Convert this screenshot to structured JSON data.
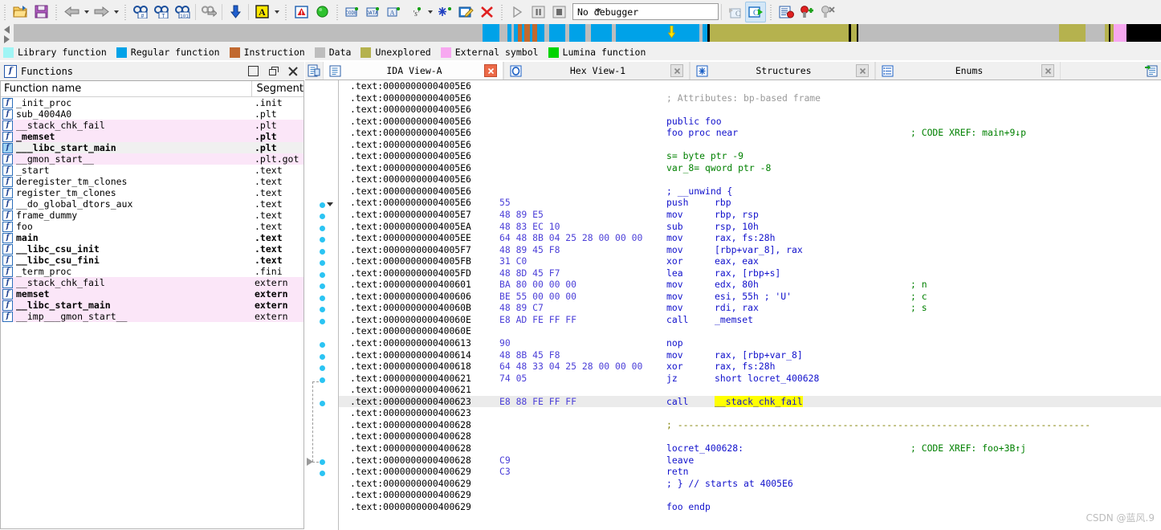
{
  "toolbar": {
    "groups": [
      {
        "items": [
          {
            "name": "open-file-icon",
            "label": "Open"
          },
          {
            "name": "save-icon",
            "label": "Save"
          }
        ]
      },
      {
        "items": [
          {
            "name": "back-arrow-icon",
            "label": "Back"
          },
          {
            "name": "back-dropdown-icon",
            "label": "Back history"
          },
          {
            "name": "forward-arrow-icon",
            "label": "Forward"
          },
          {
            "name": "forward-dropdown-icon",
            "label": "Forward history"
          }
        ]
      },
      {
        "items": [
          {
            "name": "jump-to-address-icon",
            "label": "Jump to address"
          },
          {
            "name": "jump-to-name-icon",
            "label": "Jump by name"
          },
          {
            "name": "jump-to-entry-icon",
            "label": "Jump to entry point"
          },
          {
            "name": "jump-to-xref-icon",
            "label": "Jump to xref"
          },
          {
            "name": "search-down-icon",
            "label": "Search down"
          },
          {
            "name": "text-search-icon",
            "label": "Text search"
          },
          {
            "name": "text-search-dropdown-icon",
            "label": "Search options"
          },
          {
            "name": "warning-icon",
            "label": "Problems"
          },
          {
            "name": "green-circle-icon",
            "label": "Run"
          }
        ]
      },
      {
        "items": [
          {
            "name": "make-code-icon",
            "label": "Make code"
          },
          {
            "name": "make-data-icon",
            "label": "Make data"
          },
          {
            "name": "make-array-icon",
            "label": "Make array"
          },
          {
            "name": "make-string-icon",
            "label": "Make string"
          },
          {
            "name": "make-string-dropdown-icon",
            "label": "String options"
          },
          {
            "name": "make-struct-icon",
            "label": "Make struct"
          },
          {
            "name": "edit-function-icon",
            "label": "Edit function"
          },
          {
            "name": "undefine-icon",
            "label": "Undefine"
          }
        ]
      },
      {
        "items": [
          {
            "name": "run-debugger-icon",
            "label": "Start process"
          },
          {
            "name": "pause-debugger-icon",
            "label": "Pause process"
          },
          {
            "name": "stop-debugger-icon",
            "label": "Terminate process"
          }
        ]
      }
    ],
    "debugger_select": {
      "value": "No debugger",
      "placeholder": "No debugger"
    },
    "post_select": [
      {
        "name": "step-over-source-icon",
        "label": "Step over (source)"
      },
      {
        "name": "step-into-source-icon",
        "label": "Step into (source)"
      },
      {
        "name": "breakpoint-list-icon",
        "label": "Breakpoint list"
      },
      {
        "name": "add-breakpoint-icon",
        "label": "Add breakpoint"
      },
      {
        "name": "delete-breakpoint-icon",
        "label": "Delete breakpoint"
      }
    ]
  },
  "navband": {
    "cursor_position_pct": 57.3,
    "segments": [
      {
        "color": "#bdbdbd",
        "w": 57.2
      },
      {
        "color": "#00a2e8",
        "w": 2.1
      },
      {
        "color": "#bdbdbd",
        "w": 0.9
      },
      {
        "color": "#00a2e8",
        "w": 0.5
      },
      {
        "color": "#bdbdbd",
        "w": 0.3
      },
      {
        "color": "#00a2e8",
        "w": 0.5
      },
      {
        "color": "#c1692f",
        "w": 0.5
      },
      {
        "color": "#00a2e8",
        "w": 0.3
      },
      {
        "color": "#c1692f",
        "w": 0.7
      },
      {
        "color": "#00a2e8",
        "w": 0.3
      },
      {
        "color": "#c1692f",
        "w": 0.6
      },
      {
        "color": "#00a2e8",
        "w": 0.9
      },
      {
        "color": "#bdbdbd",
        "w": 0.5
      },
      {
        "color": "#00a2e8",
        "w": 2.0
      },
      {
        "color": "#bdbdbd",
        "w": 0.5
      },
      {
        "color": "#00a2e8",
        "w": 2.0
      },
      {
        "color": "#bdbdbd",
        "w": 0.6
      },
      {
        "color": "#00a2e8",
        "w": 2.6
      },
      {
        "color": "#bdbdbd",
        "w": 0.5
      },
      {
        "color": "#00a2e8",
        "w": 10.2
      },
      {
        "color": "#bdbdbd",
        "w": 0.4
      },
      {
        "color": "#00a2e8",
        "w": 0.5
      },
      {
        "color": "#000000",
        "w": 0.3
      },
      {
        "color": "#b5b24e",
        "w": 17.0
      },
      {
        "color": "#000000",
        "w": 0.3
      },
      {
        "color": "#b5b24e",
        "w": 0.7
      },
      {
        "color": "#000000",
        "w": 0.2
      },
      {
        "color": "#bdbdbd",
        "w": 24.5
      },
      {
        "color": "#b5b24e",
        "w": 3.2
      },
      {
        "color": "#bdbdbd",
        "w": 2.3
      },
      {
        "color": "#b5b24e",
        "w": 0.5
      },
      {
        "color": "#000000",
        "w": 0.2
      },
      {
        "color": "#b5b24e",
        "w": 0.4
      },
      {
        "color": "#f7a8f0",
        "w": 1.6
      },
      {
        "color": "#000000",
        "w": 4.2
      }
    ]
  },
  "legend": {
    "items": [
      {
        "label": "Library function",
        "color": "#a0f5f5"
      },
      {
        "label": "Regular function",
        "color": "#00a2e8"
      },
      {
        "label": "Instruction",
        "color": "#c1692f"
      },
      {
        "label": "Data",
        "color": "#bdbdbd"
      },
      {
        "label": "Unexplored",
        "color": "#b5b24e"
      },
      {
        "label": "External symbol",
        "color": "#f7a8f0"
      },
      {
        "label": "Lumina function",
        "color": "#00d400"
      }
    ]
  },
  "functions_panel": {
    "title": "Functions",
    "icon": "function-f-icon",
    "window_buttons": [
      {
        "name": "maximize-button",
        "label": "Maximize"
      },
      {
        "name": "restore-button",
        "label": "Restore"
      },
      {
        "name": "close-button",
        "label": "Close"
      }
    ],
    "columns": [
      "Function name",
      "Segment"
    ],
    "rows": [
      {
        "name": "_init_proc",
        "segment": ".init",
        "bold": false,
        "bg": "white",
        "icon_sel": false
      },
      {
        "name": "sub_4004A0",
        "segment": ".plt",
        "bold": false,
        "bg": "white",
        "icon_sel": false
      },
      {
        "name": "__stack_chk_fail",
        "segment": ".plt",
        "bold": false,
        "bg": "pink",
        "icon_sel": false
      },
      {
        "name": "_memset",
        "segment": ".plt",
        "bold": true,
        "bg": "pink",
        "icon_sel": false
      },
      {
        "name": "___libc_start_main",
        "segment": ".plt",
        "bold": true,
        "bg": "grey",
        "icon_sel": true
      },
      {
        "name": "__gmon_start__",
        "segment": ".plt.got",
        "bold": false,
        "bg": "pink",
        "icon_sel": false
      },
      {
        "name": "_start",
        "segment": ".text",
        "bold": false,
        "bg": "white",
        "icon_sel": false
      },
      {
        "name": "deregister_tm_clones",
        "segment": ".text",
        "bold": false,
        "bg": "white",
        "icon_sel": false
      },
      {
        "name": "register_tm_clones",
        "segment": ".text",
        "bold": false,
        "bg": "white",
        "icon_sel": false
      },
      {
        "name": "__do_global_dtors_aux",
        "segment": ".text",
        "bold": false,
        "bg": "white",
        "icon_sel": false
      },
      {
        "name": "frame_dummy",
        "segment": ".text",
        "bold": false,
        "bg": "white",
        "icon_sel": false
      },
      {
        "name": "foo",
        "segment": ".text",
        "bold": false,
        "bg": "white",
        "icon_sel": false
      },
      {
        "name": "main",
        "segment": ".text",
        "bold": true,
        "bg": "white",
        "icon_sel": false
      },
      {
        "name": "__libc_csu_init",
        "segment": ".text",
        "bold": true,
        "bg": "white",
        "icon_sel": false
      },
      {
        "name": "__libc_csu_fini",
        "segment": ".text",
        "bold": true,
        "bg": "white",
        "icon_sel": false
      },
      {
        "name": "_term_proc",
        "segment": ".fini",
        "bold": false,
        "bg": "white",
        "icon_sel": false
      },
      {
        "name": "__stack_chk_fail",
        "segment": "extern",
        "bold": false,
        "bg": "pink",
        "icon_sel": false
      },
      {
        "name": "memset",
        "segment": "extern",
        "bold": true,
        "bg": "pink",
        "icon_sel": false
      },
      {
        "name": "__libc_start_main",
        "segment": "extern",
        "bold": true,
        "bg": "pink",
        "icon_sel": false
      },
      {
        "name": "__imp___gmon_start__",
        "segment": "extern",
        "bold": false,
        "bg": "pink",
        "icon_sel": false
      }
    ]
  },
  "tabs": {
    "lead_icon": "open-subview-icon",
    "items": [
      {
        "label": "IDA View-A",
        "icon": "ida-view-icon",
        "active": true,
        "close": "close-tab-icon"
      },
      {
        "label": "Hex View-1",
        "icon": "hex-view-icon",
        "active": false,
        "close": "close-tab-icon"
      },
      {
        "label": "Structures",
        "icon": "structures-icon",
        "active": false,
        "close": "close-tab-icon"
      },
      {
        "label": "Enums",
        "icon": "enums-icon",
        "active": false,
        "close": "close-tab-icon"
      }
    ],
    "trail_icon": "new-subview-icon"
  },
  "disassembly": {
    "segment_prefix": ".text:",
    "lines": [
      {
        "addr": ".text:00000000004005E6",
        "bytes": "",
        "mnem": "",
        "ops": "",
        "kind": "blank",
        "dot": false
      },
      {
        "addr": ".text:00000000004005E6",
        "bytes": "",
        "attr": "; Attributes: bp-based frame",
        "kind": "attr",
        "dot": false
      },
      {
        "addr": ".text:00000000004005E6",
        "bytes": "",
        "kind": "blank",
        "dot": false
      },
      {
        "addr": ".text:00000000004005E6",
        "bytes": "",
        "mnem": "public foo",
        "kind": "decl",
        "dot": false
      },
      {
        "addr": ".text:00000000004005E6",
        "bytes": "",
        "mnem": "foo proc near",
        "cmt2": "; CODE XREF: main+9↓p",
        "kind": "decl",
        "dot": false
      },
      {
        "addr": ".text:00000000004005E6",
        "bytes": "",
        "kind": "blank",
        "dot": false
      },
      {
        "addr": ".text:00000000004005E6",
        "bytes": "",
        "green": "s= byte ptr -9",
        "kind": "var",
        "dot": false
      },
      {
        "addr": ".text:00000000004005E6",
        "bytes": "",
        "green": "var_8= qword ptr -8",
        "kind": "var",
        "dot": false
      },
      {
        "addr": ".text:00000000004005E6",
        "bytes": "",
        "kind": "blank",
        "dot": false
      },
      {
        "addr": ".text:00000000004005E6",
        "bytes": "",
        "mnem": "; __unwind {",
        "kind": "decl",
        "dot": false
      },
      {
        "addr": ".text:00000000004005E6",
        "bytes": "55",
        "mnem": "push",
        "ops": "rbp",
        "kind": "insn",
        "dot": true,
        "chev": true
      },
      {
        "addr": ".text:00000000004005E7",
        "bytes": "48 89 E5",
        "mnem": "mov",
        "ops": "rbp, rsp",
        "kind": "insn",
        "dot": true
      },
      {
        "addr": ".text:00000000004005EA",
        "bytes": "48 83 EC 10",
        "mnem": "sub",
        "ops": "rsp, 10h",
        "kind": "insn",
        "dot": true
      },
      {
        "addr": ".text:00000000004005EE",
        "bytes": "64 48 8B 04 25 28 00 00 00",
        "mnem": "mov",
        "ops": "rax, fs:28h",
        "kind": "insn",
        "dot": true
      },
      {
        "addr": ".text:00000000004005F7",
        "bytes": "48 89 45 F8",
        "mnem": "mov",
        "ops": "[rbp+var_8], rax",
        "kind": "insn",
        "dot": true
      },
      {
        "addr": ".text:00000000004005FB",
        "bytes": "31 C0",
        "mnem": "xor",
        "ops": "eax, eax",
        "kind": "insn",
        "dot": true
      },
      {
        "addr": ".text:00000000004005FD",
        "bytes": "48 8D 45 F7",
        "mnem": "lea",
        "ops": "rax, [rbp+s]",
        "kind": "insn",
        "dot": true
      },
      {
        "addr": ".text:0000000000400601",
        "bytes": "BA 80 00 00 00",
        "mnem": "mov",
        "ops": "edx, 80h",
        "cmt2": "; n",
        "kind": "insn",
        "dot": true
      },
      {
        "addr": ".text:0000000000400606",
        "bytes": "BE 55 00 00 00",
        "mnem": "mov",
        "ops": "esi, 55h ; 'U'",
        "cmt2": "; c",
        "kind": "insn",
        "dot": true
      },
      {
        "addr": ".text:000000000040060B",
        "bytes": "48 89 C7",
        "mnem": "mov",
        "ops": "rdi, rax",
        "cmt2": "; s",
        "kind": "insn",
        "dot": true
      },
      {
        "addr": ".text:000000000040060E",
        "bytes": "E8 AD FE FF FF",
        "mnem": "call",
        "ops": "_memset",
        "kind": "insn",
        "dot": true
      },
      {
        "addr": ".text:000000000040060E",
        "bytes": "",
        "kind": "blank",
        "dot": false
      },
      {
        "addr": ".text:0000000000400613",
        "bytes": "90",
        "mnem": "nop",
        "ops": "",
        "kind": "insn",
        "dot": true
      },
      {
        "addr": ".text:0000000000400614",
        "bytes": "48 8B 45 F8",
        "mnem": "mov",
        "ops": "rax, [rbp+var_8]",
        "kind": "insn",
        "dot": true
      },
      {
        "addr": ".text:0000000000400618",
        "bytes": "64 48 33 04 25 28 00 00 00",
        "mnem": "xor",
        "ops": "rax, fs:28h",
        "kind": "insn",
        "dot": true
      },
      {
        "addr": ".text:0000000000400621",
        "bytes": "74 05",
        "mnem": "jz",
        "ops": "short locret_400628",
        "kind": "insn",
        "dot": true
      },
      {
        "addr": ".text:0000000000400621",
        "bytes": "",
        "kind": "blank",
        "dot": false
      },
      {
        "addr": ".text:0000000000400623",
        "bytes": "E8 88 FE FF FF",
        "mnem": "call",
        "ops": "__stack_chk_fail",
        "highlight_op": true,
        "kind": "insn",
        "dot": true,
        "row_hl": true
      },
      {
        "addr": ".text:0000000000400623",
        "bytes": "",
        "kind": "blank",
        "dot": false
      },
      {
        "addr": ".text:0000000000400628",
        "bytes": "",
        "dashline": "; ---------------------------------------------------------------------------",
        "kind": "dash",
        "dot": false
      },
      {
        "addr": ".text:0000000000400628",
        "bytes": "",
        "kind": "blank",
        "dot": false
      },
      {
        "addr": ".text:0000000000400628",
        "bytes": "",
        "mnem": "locret_400628:",
        "cmt2": "; CODE XREF: foo+3B↑j",
        "kind": "label",
        "dot": false
      },
      {
        "addr": ".text:0000000000400628",
        "bytes": "C9",
        "mnem": "leave",
        "ops": "",
        "kind": "insn",
        "dot": true,
        "arrowhead": true
      },
      {
        "addr": ".text:0000000000400629",
        "bytes": "C3",
        "mnem": "retn",
        "ops": "",
        "kind": "insn",
        "dot": true
      },
      {
        "addr": ".text:0000000000400629",
        "bytes": "",
        "mnem": "; } // starts at 4005E6",
        "kind": "decl",
        "dot": false
      },
      {
        "addr": ".text:0000000000400629",
        "bytes": "",
        "kind": "blank",
        "dot": false
      },
      {
        "addr": ".text:0000000000400629",
        "bytes": "",
        "mnem": "foo endp",
        "kind": "decl",
        "dot": false
      }
    ]
  },
  "watermark": "CSDN @蓝风.9"
}
